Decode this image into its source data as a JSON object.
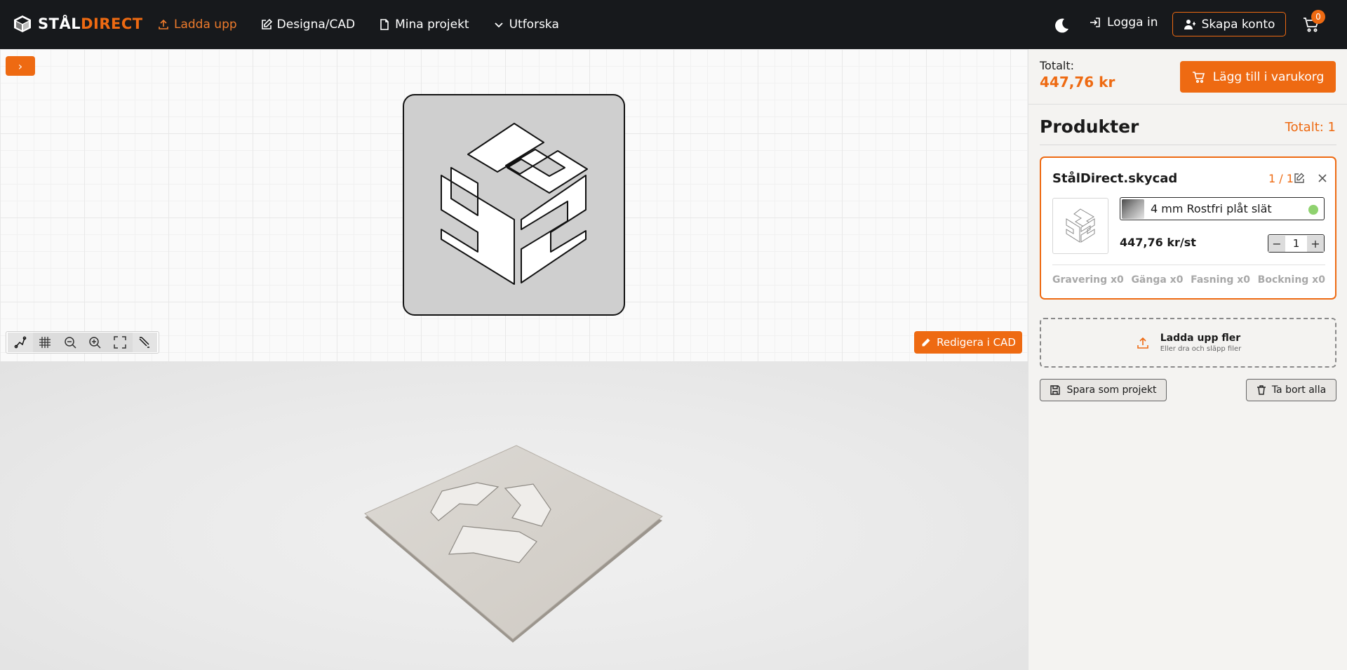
{
  "brand": {
    "name_part1": "STÅL",
    "name_part2": "DIRECT",
    "accent": "#ee6a12",
    "topbar_bg": "#17191c"
  },
  "nav": {
    "items": [
      {
        "label": "Ladda upp",
        "icon": "upload-icon",
        "active": true
      },
      {
        "label": "Designa/CAD",
        "icon": "pencil-square-icon",
        "active": false
      },
      {
        "label": "Mina projekt",
        "icon": "document-icon",
        "active": false
      },
      {
        "label": "Utforska",
        "icon": "chevron-down-icon",
        "active": false
      }
    ],
    "login_label": "Logga in",
    "signup_label": "Skapa konto",
    "cart_count": "0"
  },
  "viewer": {
    "expand_label": "›",
    "tools": [
      "select-node-icon",
      "grid-icon",
      "zoom-out-icon",
      "zoom-in-icon",
      "fit-screen-icon",
      "measure-icon"
    ],
    "edit_cad_label": "Redigera i CAD"
  },
  "cart_summary": {
    "total_label": "Totalt:",
    "total_value": "447,76 kr",
    "add_to_cart_label": "Lägg till i varukorg"
  },
  "products": {
    "title": "Produkter",
    "total_label": "Totalt: 1",
    "items": [
      {
        "name": "StålDirect.skycad",
        "count": "1 / 1",
        "material": "4 mm Rostfri plåt slät",
        "price": "447,76 kr/st",
        "quantity": "1",
        "operations": [
          "Gravering x0",
          "Gänga x0",
          "Fasning x0",
          "Bockning x0"
        ]
      }
    ]
  },
  "upload_more": {
    "title": "Ladda upp fler",
    "subtitle": "Eller dra och släpp filer"
  },
  "actions": {
    "save_label": "Spara som projekt",
    "delete_label": "Ta bort alla"
  }
}
